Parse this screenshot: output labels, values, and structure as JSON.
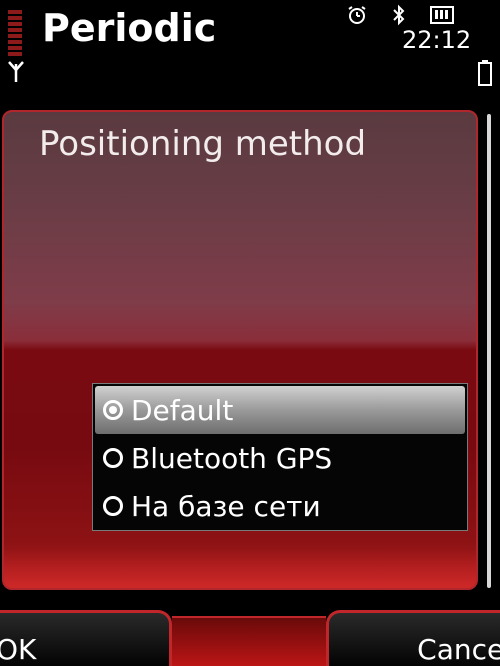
{
  "status_bar": {
    "app_title": "Periodic",
    "time": "22:12",
    "icons": {
      "signal": "signal-strength-icon",
      "antenna": "antenna-icon",
      "alarm": "alarm-icon",
      "bluetooth": "bluetooth-icon",
      "profile": "profile-icon",
      "battery": "battery-icon"
    }
  },
  "dialog": {
    "title": "Positioning method",
    "options": [
      {
        "label": "Default",
        "selected": true
      },
      {
        "label": "Bluetooth GPS",
        "selected": false
      },
      {
        "label": "На базе сети",
        "selected": false
      }
    ]
  },
  "softkeys": {
    "left": "OK",
    "right": "Cancel"
  },
  "colors": {
    "accent": "#c0262a",
    "panel_top": "#5a3a40",
    "panel_bottom": "#b01c1c",
    "text": "#ffffff"
  }
}
